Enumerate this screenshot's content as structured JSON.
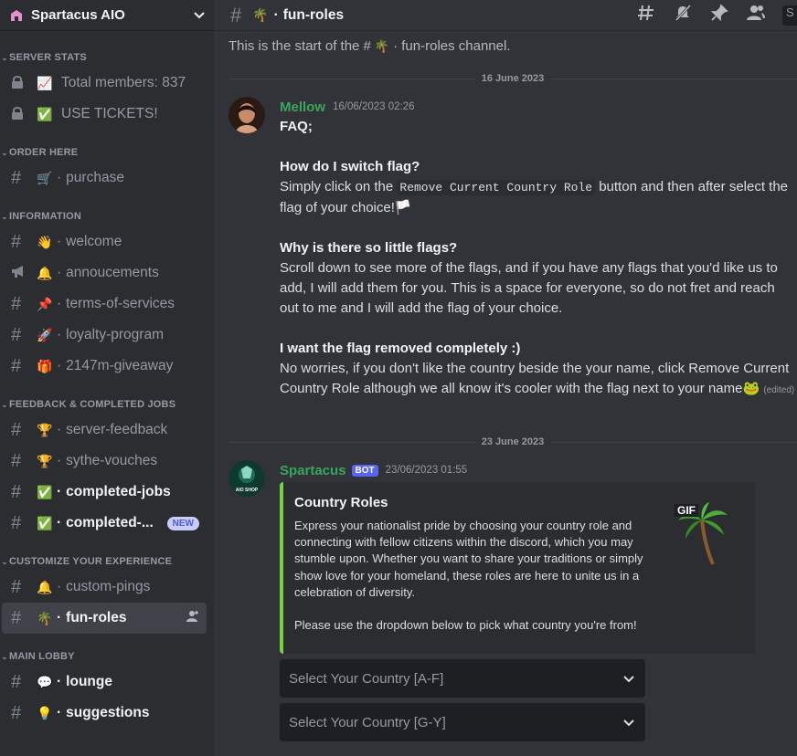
{
  "server": {
    "name": "Spartacus AIO",
    "icon": "server-emblem-icon"
  },
  "sidebar": {
    "categories": [
      {
        "name": "SERVER STATS",
        "channels": [
          {
            "prefix": "lock",
            "emoji": "📈",
            "label": "Total members: 837"
          },
          {
            "prefix": "lock",
            "emoji": "✅",
            "label": "USE TICKETS!"
          }
        ]
      },
      {
        "name": "ORDER HERE",
        "channels": [
          {
            "prefix": "#",
            "emoji": "🛒",
            "label": "purchase"
          }
        ]
      },
      {
        "name": "INFORMATION",
        "channels": [
          {
            "prefix": "#",
            "emoji": "👋",
            "label": "welcome"
          },
          {
            "prefix": "announce",
            "emoji": "🔔",
            "label": "annoucements"
          },
          {
            "prefix": "#",
            "emoji": "📌",
            "label": "terms-of-services"
          },
          {
            "prefix": "#",
            "emoji": "🚀",
            "label": "loyalty-program"
          },
          {
            "prefix": "#",
            "emoji": "🎁",
            "label": "2147m-giveaway"
          }
        ]
      },
      {
        "name": "FEEDBACK & COMPLETED JOBS",
        "channels": [
          {
            "prefix": "#",
            "emoji": "🏆",
            "label": "server-feedback"
          },
          {
            "prefix": "#",
            "emoji": "🏆",
            "label": "sythe-vouches"
          },
          {
            "prefix": "#",
            "emoji": "✅",
            "label": "completed-jobs"
          },
          {
            "prefix": "#",
            "emoji": "✅",
            "label": "completed-...",
            "badge": "NEW"
          }
        ]
      },
      {
        "name": "CUSTOMIZE YOUR EXPERIENCE",
        "channels": [
          {
            "prefix": "#",
            "emoji": "🔔",
            "label": "custom-pings"
          },
          {
            "prefix": "#",
            "emoji": "🌴",
            "label": "fun-roles"
          }
        ]
      },
      {
        "name": "MAIN LOBBY",
        "channels": [
          {
            "prefix": "#",
            "emoji": "💬",
            "label": "lounge"
          },
          {
            "prefix": "#",
            "emoji": "💡",
            "label": "suggestions"
          }
        ]
      }
    ]
  },
  "channel": {
    "emoji": "🌴",
    "name": "fun-roles",
    "start_text_a": "This is the start of the #",
    "start_text_b": "· fun-roles channel."
  },
  "dates": {
    "first": "16 June 2023",
    "second": "23 June 2023"
  },
  "message1": {
    "author": "Mellow",
    "author_color": "#3ba55d",
    "timestamp": "16/06/2023 02:26",
    "faq": "FAQ;",
    "q1": "How do I switch flag?",
    "a1_pre": "Simply click on the",
    "a1_code": "Remove Current Country Role",
    "a1_post": "button and then after select the flag of your choice!",
    "a1_emoji": "🏳️",
    "q2": "Why is there so little flags?",
    "a2": "Scroll down to see more of the flags, and if you have any flags that you'd like us to add, I will add them for you. This is a space for everyone, so do not fret and reach out to me and I will add the flag of your choice.",
    "q3": "I want the flag removed completely :)",
    "a3": "No worries, if you don't like the country beside the your name, click Remove Current Country Role although we all know it's cooler with the flag next to your name",
    "a3_emoji": "🐸",
    "edited": "(edited)"
  },
  "message2": {
    "author": "Spartacus",
    "author_color": "#3ba55d",
    "bot_tag": "BOT",
    "timestamp": "23/06/2023 01:55",
    "avatar_text": "SPARTACUS AIO SHOP",
    "embed": {
      "title": "Country Roles",
      "desc1": "Express your nationalist pride by choosing your country role and connecting with fellow citizens within the discord, which you may stumble upon. Whether you want to share your traditions or simply show love for your homeland, these roles are here to unite us in a celebration of diversity.",
      "desc2": "Please use the dropdown below to pick what country you're from!",
      "gif_label": "GIF",
      "accent": "#78d23c"
    },
    "selects": [
      {
        "placeholder": "Select Your Country [A-F]"
      },
      {
        "placeholder": "Select Your Country [G-Y]"
      }
    ]
  },
  "topbar_icons": [
    "threads-icon",
    "mute-bell-icon",
    "pin-icon",
    "members-icon"
  ]
}
